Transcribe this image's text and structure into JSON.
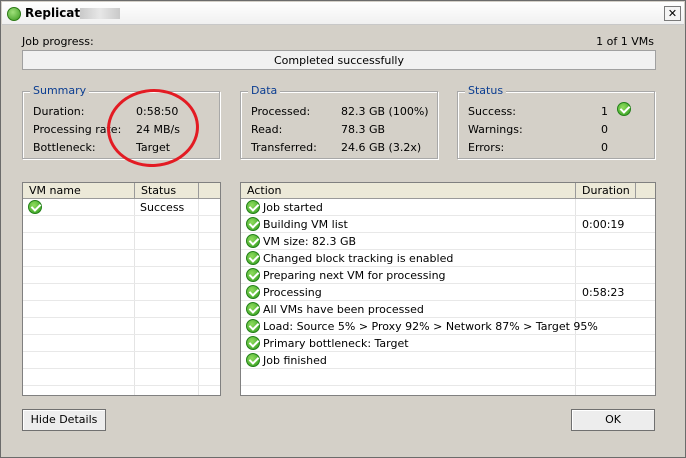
{
  "window": {
    "title": "Replicate",
    "close_glyph": "✕"
  },
  "job_progress": {
    "label": "Job progress:",
    "count": "1 of 1 VMs",
    "status": "Completed successfully",
    "percent": 100
  },
  "summary": {
    "title": "Summary",
    "rows": [
      {
        "label": "Duration:",
        "value": "0:58:50"
      },
      {
        "label": "Processing rate:",
        "value": "24 MB/s"
      },
      {
        "label": "Bottleneck:",
        "value": "Target"
      }
    ]
  },
  "data": {
    "title": "Data",
    "rows": [
      {
        "label": "Processed:",
        "value": "82.3 GB (100%)"
      },
      {
        "label": "Read:",
        "value": "78.3 GB"
      },
      {
        "label": "Transferred:",
        "value": "24.6 GB (3.2x)"
      }
    ]
  },
  "status": {
    "title": "Status",
    "rows": [
      {
        "label": "Success:",
        "value": "1"
      },
      {
        "label": "Warnings:",
        "value": "0"
      },
      {
        "label": "Errors:",
        "value": "0"
      }
    ]
  },
  "vm_list": {
    "headers": {
      "vm_name": "VM name",
      "status": "Status"
    },
    "rows": [
      {
        "name": "",
        "status": "Success"
      }
    ]
  },
  "actions": {
    "headers": {
      "action": "Action",
      "duration": "Duration"
    },
    "rows": [
      {
        "text": "Job started",
        "duration": ""
      },
      {
        "text": "Building VM list",
        "duration": "0:00:19"
      },
      {
        "text": "VM size: 82.3 GB",
        "duration": ""
      },
      {
        "text": "Changed block tracking is enabled",
        "duration": ""
      },
      {
        "text": "Preparing next VM for processing",
        "duration": ""
      },
      {
        "text": "Processing",
        "duration": "0:58:23"
      },
      {
        "text": "All VMs have been processed",
        "duration": ""
      },
      {
        "text": "Load: Source 5% > Proxy 92% > Network 87% > Target 95%",
        "duration": ""
      },
      {
        "text": "Primary bottleneck: Target",
        "duration": ""
      },
      {
        "text": "Job finished",
        "duration": ""
      }
    ]
  },
  "buttons": {
    "hide_details": "Hide Details",
    "ok": "OK"
  },
  "colors": {
    "group_title": "#0b3d91",
    "annotation_circle": "#e31b23",
    "success_icon": "#2f9c1c"
  }
}
